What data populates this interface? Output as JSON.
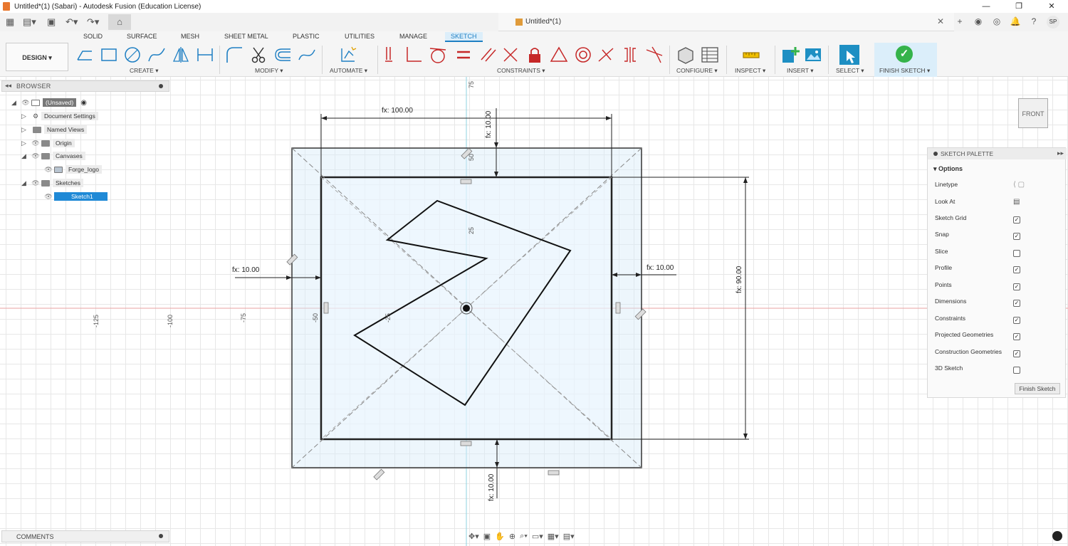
{
  "window": {
    "title": "Untitled*(1) (Sabari) - Autodesk Fusion (Education License)",
    "controls": [
      "—",
      "❐",
      "✕"
    ]
  },
  "quick_access": {
    "doc_tab_title": "Untitled*(1)",
    "avatar": "SP"
  },
  "ribbon": {
    "tabs": [
      "SOLID",
      "SURFACE",
      "MESH",
      "SHEET METAL",
      "PLASTIC",
      "UTILITIES",
      "MANAGE",
      "SKETCH"
    ],
    "active_tab": "SKETCH",
    "design_label": "DESIGN ▾",
    "groups": {
      "create": "CREATE ▾",
      "modify": "MODIFY ▾",
      "automate": "AUTOMATE ▾",
      "constraints": "CONSTRAINTS ▾",
      "configure": "CONFIGURE ▾",
      "inspect": "INSPECT ▾",
      "insert": "INSERT ▾",
      "select": "SELECT ▾",
      "finish_sketch": "FINISH SKETCH ▾"
    }
  },
  "browser": {
    "title": "BROWSER",
    "items": [
      {
        "label": "(Unsaved)"
      },
      {
        "label": "Document Settings"
      },
      {
        "label": "Named Views"
      },
      {
        "label": "Origin"
      },
      {
        "label": "Canvases"
      },
      {
        "label": "Forge_logo"
      },
      {
        "label": "Sketches"
      },
      {
        "label": "Sketch1"
      }
    ]
  },
  "comments": {
    "title": "COMMENTS"
  },
  "sketch_palette": {
    "title": "SKETCH PALETTE",
    "section": "Options",
    "rows": [
      {
        "label": "Linetype"
      },
      {
        "label": "Look At"
      },
      {
        "label": "Sketch Grid",
        "checked": true
      },
      {
        "label": "Snap",
        "checked": true
      },
      {
        "label": "Slice",
        "checked": false
      },
      {
        "label": "Profile",
        "checked": true
      },
      {
        "label": "Points",
        "checked": true
      },
      {
        "label": "Dimensions",
        "checked": true
      },
      {
        "label": "Constraints",
        "checked": true
      },
      {
        "label": "Projected Geometries",
        "checked": true
      },
      {
        "label": "Construction Geometries",
        "checked": true
      },
      {
        "label": "3D Sketch",
        "checked": false
      }
    ],
    "finish_button": "Finish Sketch"
  },
  "viewcube": {
    "label": "FRONT"
  },
  "dimensions": {
    "top_width": "fx: 100.00",
    "top_offset": "fx: 10.00",
    "left_offset": "fx: 10.00",
    "right_offset": "fx: 10.00",
    "height": "fx: 90.00",
    "bottom_offset": "fx: 10.00"
  },
  "axis_ticks": {
    "x": [
      "-125",
      "-100",
      "-75",
      "-50",
      "-25"
    ],
    "y": [
      "75",
      "50",
      "25"
    ]
  },
  "colors": {
    "accent": "#1e7fc3",
    "finish_green": "#35b34a",
    "selection_blue": "#1f89d6"
  }
}
